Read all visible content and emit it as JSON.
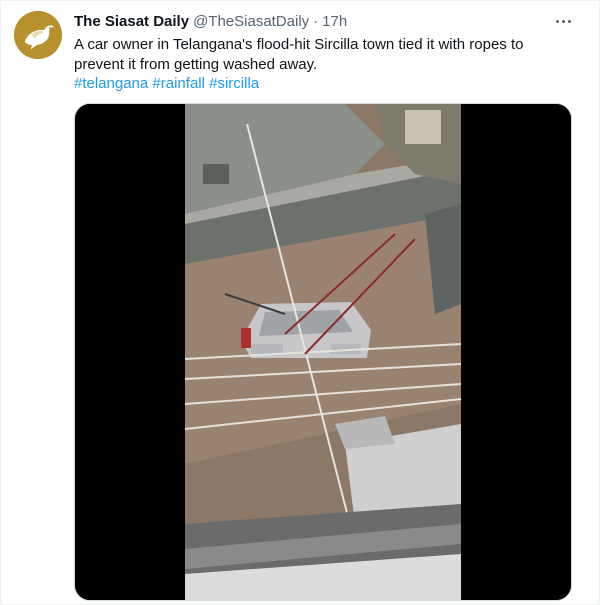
{
  "tweet": {
    "display_name": "The Siasat Daily",
    "handle": "@TheSiasatDaily",
    "separator": "·",
    "time": "17h",
    "text": "A car owner in Telangana's flood-hit Sircilla town tied it with ropes to prevent it from getting washed away.",
    "hashtags": [
      "#telangana",
      "#rainfall",
      "#sircilla"
    ],
    "avatar_icon": "pigeon-icon",
    "more_icon": "more-options-icon",
    "colors": {
      "link": "#1d9bf0",
      "avatar_bg": "#b8912e",
      "secondary_text": "#536471"
    }
  }
}
